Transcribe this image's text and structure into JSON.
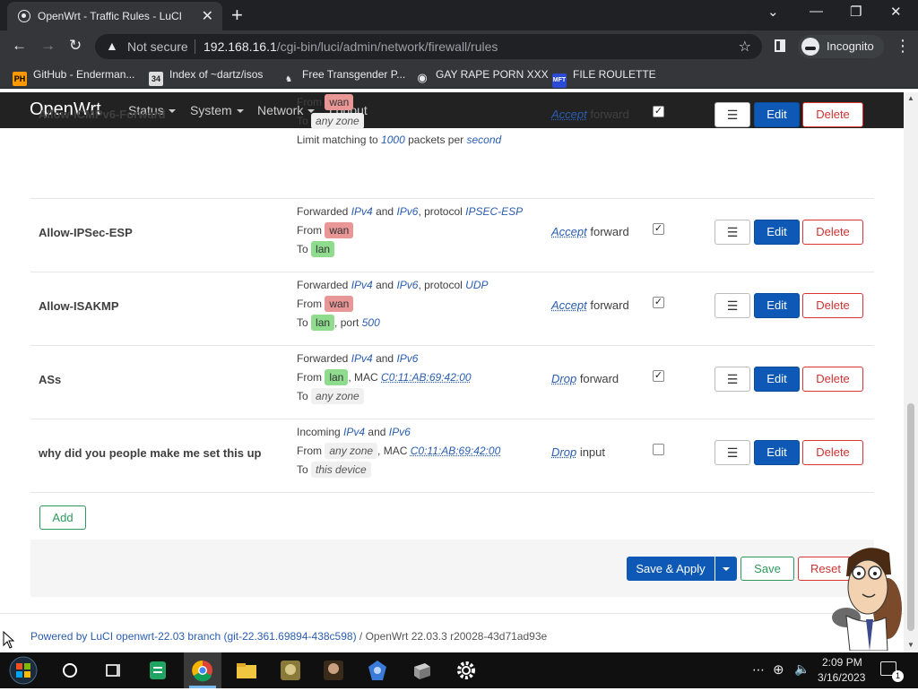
{
  "browser": {
    "tab_title": "OpenWrt - Traffic Rules - LuCI",
    "security_label": "Not secure",
    "url_host": "192.168.16.1",
    "url_path": "/cgi-bin/luci/admin/network/firewall/rules",
    "incognito_label": "Incognito",
    "bookmarks": [
      {
        "label": "GitHub - Enderman...",
        "icon": "ph-icon"
      },
      {
        "label": "Index of ~dartz/isos",
        "icon": "folder-icon"
      },
      {
        "label": "Free Transgender P...",
        "icon": "site-icon"
      },
      {
        "label": "GAY RAPE PORN XXX",
        "icon": "globe-icon"
      },
      {
        "label": "FILE ROULETTE",
        "icon": "mft-icon"
      }
    ]
  },
  "luci": {
    "brand": "OpenWrt",
    "menu": [
      "Status",
      "System",
      "Network",
      "Logout"
    ],
    "rules": [
      {
        "name": "Allow-ICMPv6-Forward",
        "lines": [
          {
            "prefix": "From",
            "zone": "wan",
            "zone_type": "wan"
          },
          {
            "prefix": "To",
            "zone": "any zone",
            "zone_type": "any"
          },
          {
            "text_a": "Limit matching to",
            "em_a": "1000",
            "text_b": "packets per",
            "em_b": "second"
          }
        ],
        "action_verb": "Accept",
        "action_target": "forward",
        "enabled": true
      },
      {
        "name": "Allow-IPSec-ESP",
        "lines": [
          {
            "text_a": "Forwarded",
            "em_a": "IPv4",
            "text_b": "and",
            "em_b": "IPv6",
            "text_c": ", protocol",
            "em_c": "IPSEC-ESP"
          },
          {
            "prefix": "From",
            "zone": "wan",
            "zone_type": "wan"
          },
          {
            "prefix": "To",
            "zone": "lan",
            "zone_type": "lan"
          }
        ],
        "action_verb": "Accept",
        "action_target": "forward",
        "enabled": true
      },
      {
        "name": "Allow-ISAKMP",
        "lines": [
          {
            "text_a": "Forwarded",
            "em_a": "IPv4",
            "text_b": "and",
            "em_b": "IPv6",
            "text_c": ", protocol",
            "em_c": "UDP"
          },
          {
            "prefix": "From",
            "zone": "wan",
            "zone_type": "wan"
          },
          {
            "prefix": "To",
            "zone": "lan",
            "zone_type": "lan",
            "suffix": ", port",
            "suffix_em": "500"
          }
        ],
        "action_verb": "Accept",
        "action_target": "forward",
        "enabled": true
      },
      {
        "name": "ASs",
        "lines": [
          {
            "text_a": "Forwarded",
            "em_a": "IPv4",
            "text_b": "and",
            "em_b": "IPv6"
          },
          {
            "prefix": "From",
            "zone": "lan",
            "zone_type": "lan",
            "suffix": ", MAC",
            "mac": "C0:11:AB:69:42:00"
          },
          {
            "prefix": "To",
            "zone": "any zone",
            "zone_type": "any"
          }
        ],
        "action_verb": "Drop",
        "action_target": "forward",
        "enabled": true
      },
      {
        "name": "why did you people make me set this up",
        "lines": [
          {
            "text_a": "Incoming",
            "em_a": "IPv4",
            "text_b": "and",
            "em_b": "IPv6"
          },
          {
            "prefix": "From",
            "zone": "any zone",
            "zone_type": "any",
            "suffix": ", MAC",
            "mac": "C0:11:AB:69:42:00"
          },
          {
            "prefix": "To",
            "zone": "this device",
            "zone_type": "any"
          }
        ],
        "action_verb": "Drop",
        "action_target": "input",
        "enabled": false
      }
    ],
    "row_buttons": {
      "sort": "☰",
      "edit": "Edit",
      "delete": "Delete"
    },
    "add_label": "Add",
    "save_apply_label": "Save & Apply",
    "save_label": "Save",
    "reset_label": "Reset",
    "footer": {
      "link": "Powered by LuCI openwrt-22.03 branch (git-22.361.69894-438c598)",
      "rest": " / OpenWrt 22.03.3 r20028-43d71ad93e"
    }
  },
  "taskbar": {
    "time": "2:09 PM",
    "date": "3/16/2023",
    "notification_count": "1"
  },
  "colors": {
    "luci_header": "#222222",
    "primary": "#0e59b5",
    "zone_wan": "#e89696",
    "zone_lan": "#8fdc8f",
    "zone_any": "#f0f0f0"
  }
}
